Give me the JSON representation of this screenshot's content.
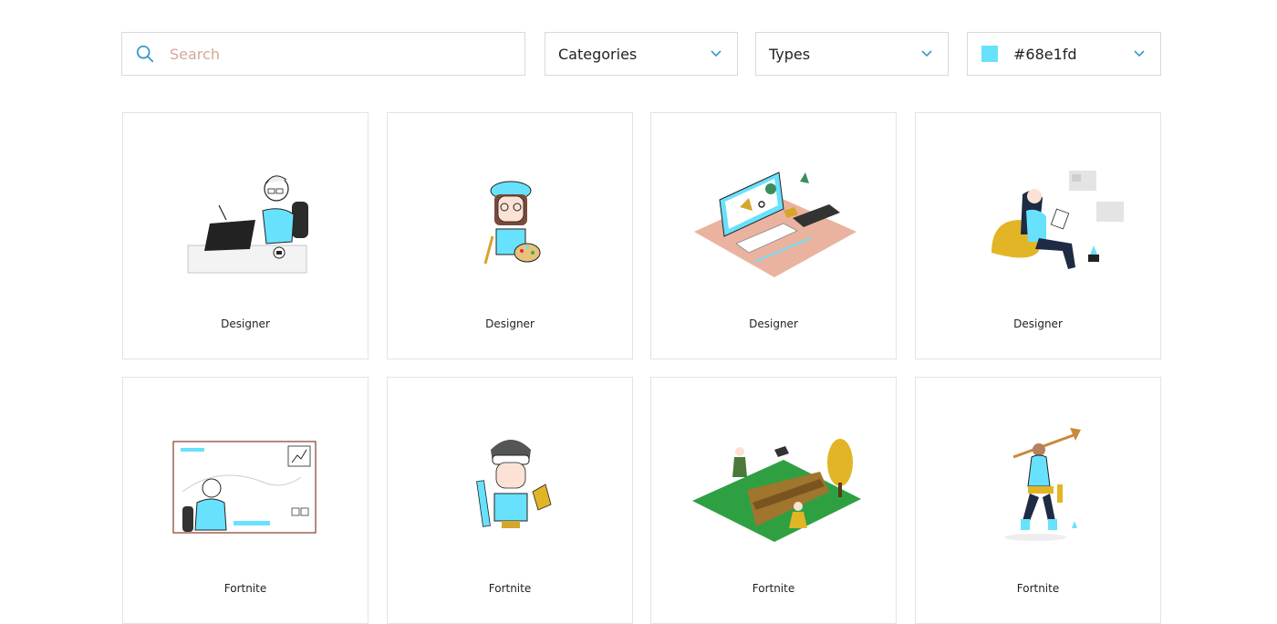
{
  "search": {
    "placeholder": "Search",
    "icon": "search-icon"
  },
  "filters": {
    "categories_label": "Categories",
    "types_label": "Types",
    "color_label": "#68e1fd",
    "color_value": "#68e1fd"
  },
  "colors": {
    "accent": "#68e1fd",
    "chevron": "#3a9cc4",
    "placeholder": "#d4a896",
    "border": "#d9d9d9"
  },
  "cards": [
    {
      "caption": "Designer",
      "illustration": "designer-at-desk-illustration"
    },
    {
      "caption": "Designer",
      "illustration": "artist-with-palette-illustration"
    },
    {
      "caption": "Designer",
      "illustration": "isometric-workspace-illustration"
    },
    {
      "caption": "Designer",
      "illustration": "woman-sketching-illustration"
    },
    {
      "caption": "Fortnite",
      "illustration": "gamer-at-screen-illustration"
    },
    {
      "caption": "Fortnite",
      "illustration": "gamer-with-blaster-illustration"
    },
    {
      "caption": "Fortnite",
      "illustration": "isometric-battlefield-illustration"
    },
    {
      "caption": "Fortnite",
      "illustration": "hero-with-pickaxe-illustration"
    }
  ]
}
